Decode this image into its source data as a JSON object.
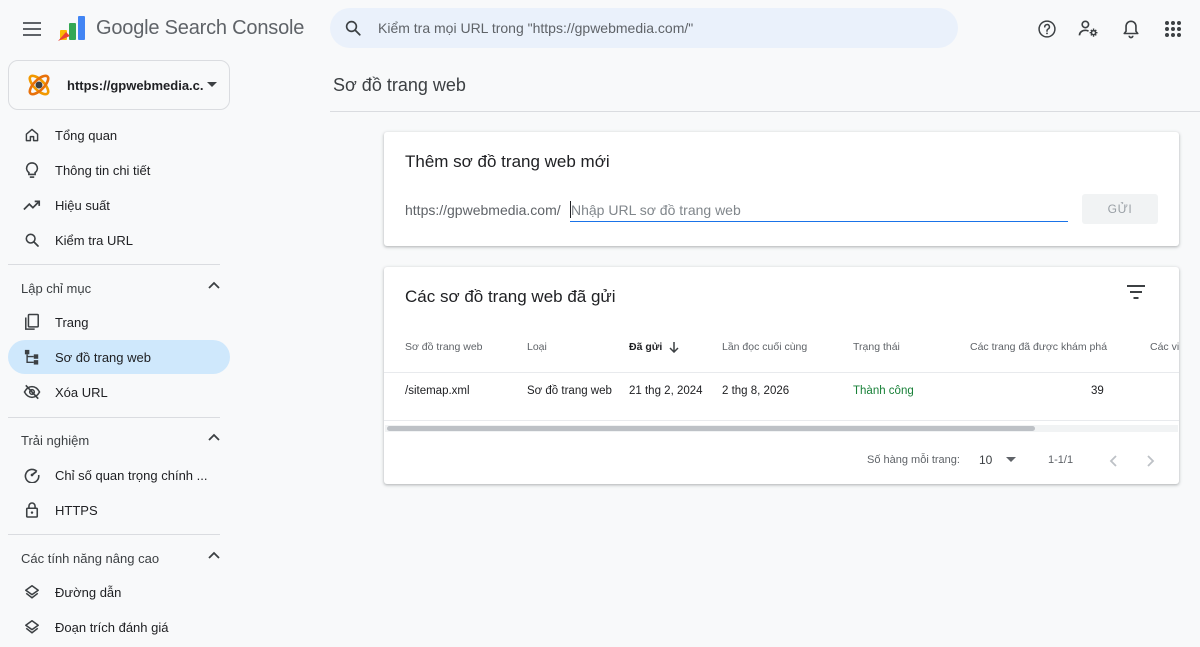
{
  "app": {
    "title": "Google Search Console",
    "search_placeholder": "Kiểm tra mọi URL trong \"https://gpwebmedia.com/\"",
    "top_icons": [
      "help-icon",
      "manage-users-icon",
      "notifications-icon",
      "apps-grid-icon"
    ]
  },
  "property": {
    "name": "https://gpwebmedia.c..."
  },
  "sidebar": {
    "items_top": [
      {
        "label": "Tổng quan",
        "icon": "home-icon"
      },
      {
        "label": "Thông tin chi tiết",
        "icon": "lightbulb-icon"
      },
      {
        "label": "Hiệu suất",
        "icon": "trending-up-icon"
      },
      {
        "label": "Kiểm tra URL",
        "icon": "search-icon"
      }
    ],
    "indexing": {
      "header": "Lập chỉ mục",
      "items": [
        {
          "label": "Trang",
          "icon": "pages-icon"
        },
        {
          "label": "Sơ đồ trang web",
          "icon": "sitemap-icon",
          "active": true
        },
        {
          "label": "Xóa URL",
          "icon": "visibility-off-icon"
        }
      ]
    },
    "experience": {
      "header": "Trải nghiệm",
      "items": [
        {
          "label": "Chỉ số quan trọng chính ...",
          "icon": "speed-gauge-icon"
        },
        {
          "label": "HTTPS",
          "icon": "lock-icon"
        }
      ]
    },
    "advanced": {
      "header": "Các tính năng nâng cao",
      "items": [
        {
          "label": "Đường dẫn",
          "icon": "layers-icon"
        },
        {
          "label": "Đoạn trích đánh giá",
          "icon": "layers-icon"
        }
      ]
    }
  },
  "main": {
    "page_title": "Sơ đồ trang web",
    "add_card": {
      "title": "Thêm sơ đồ trang web mới",
      "url_prefix": "https://gpwebmedia.com/",
      "input_placeholder": "Nhập URL sơ đồ trang web",
      "submit_label": "GỬI"
    },
    "submitted_card": {
      "title": "Các sơ đồ trang web đã gửi",
      "columns": [
        "Sơ đồ trang web",
        "Loại",
        "Đã gửi",
        "Lần đọc cuối cùng",
        "Trạng thái",
        "Các trang đã được khám phá",
        "Các vi"
      ],
      "rows": [
        {
          "sitemap": "/sitemap.xml",
          "type": "Sơ đồ trang web",
          "submitted": "21 thg 2, 2024",
          "last_read": "2 thg 8, 2026",
          "status": "Thành công",
          "discovered": "39"
        }
      ],
      "pagination": {
        "rows_per_page_label": "Số hàng mỗi trang:",
        "rows_per_page": "10",
        "range": "1-1/1"
      }
    }
  },
  "colors": {
    "accent": "#1a73e8",
    "active_nav": "#cfe8fc",
    "success": "#188038"
  }
}
